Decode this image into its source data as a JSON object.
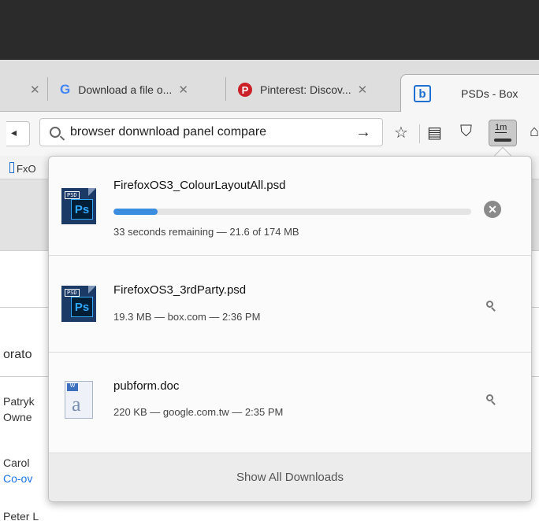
{
  "tabs": [
    {
      "label": "",
      "close": "✕"
    },
    {
      "icon": "G",
      "label": "Download a file o...",
      "close": "✕"
    },
    {
      "icon": "P",
      "label": "Pinterest: Discov...",
      "close": "✕"
    },
    {
      "icon": "b",
      "label": "PSDs - Box"
    }
  ],
  "url": {
    "value": "browser donwnload panel compare",
    "go": "→"
  },
  "toolbar": {
    "star": "☆",
    "reader": "▤",
    "pocket": "⛉",
    "downloads_badge": "1m",
    "home": "⌂"
  },
  "bookmarks": [
    {
      "label": "FxO"
    }
  ],
  "page_fragments": {
    "line1": "orato",
    "line2": "Patryk",
    "line3": "Owne",
    "line4": "Carol",
    "line5": "Co-ov",
    "line6": "Peter L"
  },
  "downloads": [
    {
      "name": "FirefoxOS3_ColourLayoutAll.psd",
      "status": "33 seconds remaining — 21.6 of 174 MB",
      "progress_fraction": 0.124,
      "icon": "psd-icon",
      "tag": "PSD",
      "glyph": "Ps"
    },
    {
      "name": "FirefoxOS3_3rdParty.psd",
      "status": "19.3 MB — box.com — 2:36 PM",
      "icon": "psd-icon",
      "tag": "PSD",
      "glyph": "Ps"
    },
    {
      "name": "pubform.doc",
      "status": "220 KB — google.com.tw — 2:35 PM",
      "icon": "doc-icon",
      "tag": "W",
      "glyph": "a"
    }
  ],
  "footer": {
    "label": "Show All Downloads"
  },
  "colors": {
    "progress": "#3b8de0",
    "brand_box": "#1f6fd1",
    "pinterest": "#cb2027",
    "google": "#4285f4"
  }
}
